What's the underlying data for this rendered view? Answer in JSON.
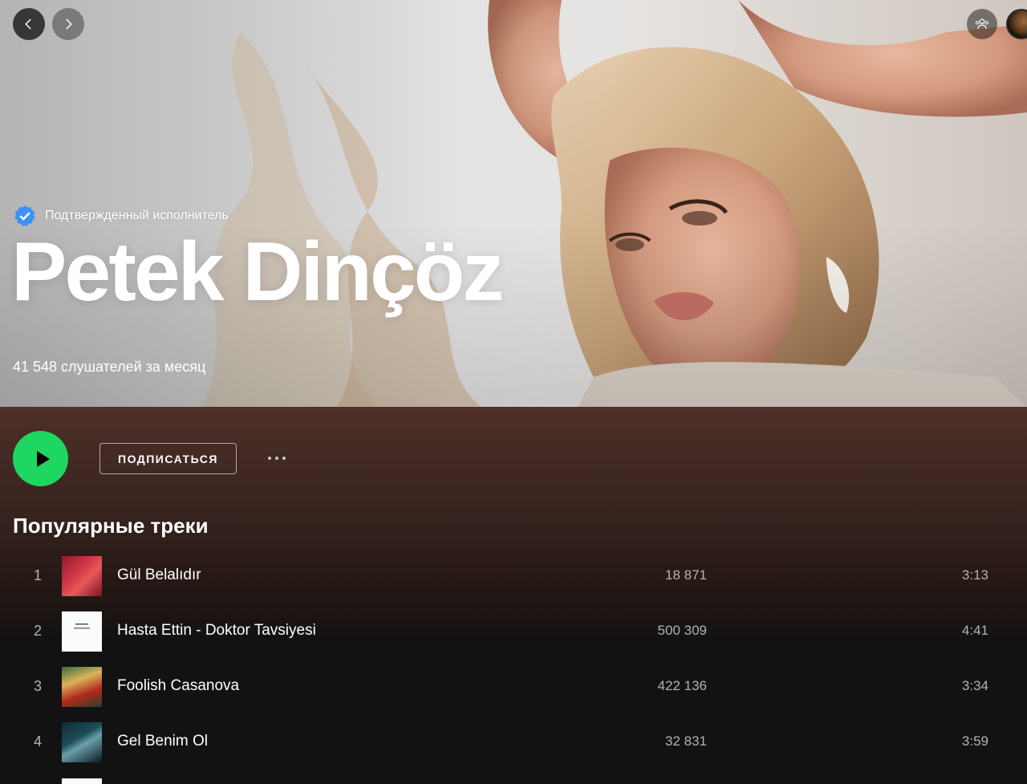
{
  "nav": {
    "back_icon": "chevron-left-icon",
    "forward_icon": "chevron-right-icon"
  },
  "header": {
    "friends_icon": "friend-activity-icon"
  },
  "artist": {
    "verified_label": "Подтвержденный исполнитель",
    "name": "Petek Dinçöz",
    "monthly_listeners": "41 548 слушателей за месяц"
  },
  "actions": {
    "play_icon": "play-icon",
    "follow_label": "ПОДПИСАТЬСЯ",
    "more_icon": "more-options-icon"
  },
  "popular": {
    "title": "Популярные треки",
    "tracks": [
      {
        "number": "1",
        "title": "Gül Belalıdır",
        "plays": "18 871",
        "duration": "3:13"
      },
      {
        "number": "2",
        "title": "Hasta Ettin - Doktor Tavsiyesi",
        "plays": "500 309",
        "duration": "4:41"
      },
      {
        "number": "3",
        "title": "Foolish Casanova",
        "plays": "422 136",
        "duration": "3:34"
      },
      {
        "number": "4",
        "title": "Gel Benim Ol",
        "plays": "32 831",
        "duration": "3:59"
      }
    ]
  },
  "colors": {
    "accent_green": "#1ed760",
    "background": "#121212",
    "header_tint": "#4e2f28",
    "muted_text": "#b3b3b3",
    "verified_blue": "#3d91f4"
  }
}
